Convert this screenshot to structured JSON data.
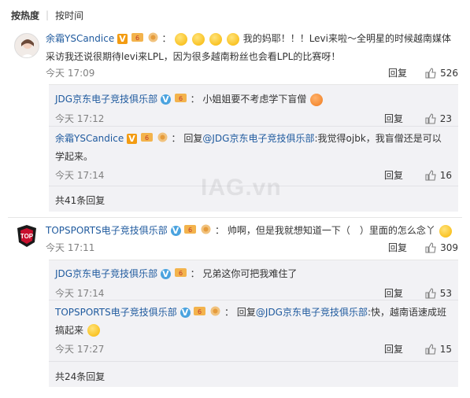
{
  "sort": {
    "hot": "按热度",
    "sep": "|",
    "time": "按时间"
  },
  "comments": [
    {
      "user": "余霜YSCandice",
      "pre_text": "：",
      "text": "我的妈耶！！！Levi来啦～全明星的时候越南媒体采访我还说很期待levi来LPL，因为很多越南粉丝也会看LPL的比赛呀！",
      "time": "今天 17:09",
      "reply": "回复",
      "likes": "526",
      "sub_comments": [
        {
          "user": "JDG京东电子竞技俱乐部",
          "sep": "：",
          "text": "小姐姐要不考虑学下盲僧",
          "time": "今天 17:12",
          "reply": "回复",
          "likes": "23"
        },
        {
          "user": "余霜YSCandice",
          "sep": "：",
          "text_prefix": "回复",
          "mention": "@JDG京东电子竞技俱乐部",
          "text": ":我觉得ojbk，我盲僧还是可以学起来。",
          "time": "今天 17:14",
          "reply": "回复",
          "likes": "16"
        }
      ],
      "more": "共41条回复"
    },
    {
      "user": "TOPSPORTS电子竞技俱乐部",
      "pre_text": "：",
      "text": "帅啊，但是我就想知道一下（　）里面的怎么念丫",
      "time": "今天 17:11",
      "reply": "回复",
      "likes": "309",
      "sub_comments": [
        {
          "user": "JDG京东电子竞技俱乐部",
          "sep": "：",
          "text": "兄弟这你可把我难住了",
          "time": "今天 17:14",
          "reply": "回复",
          "likes": "53"
        },
        {
          "user": "TOPSPORTS电子竞技俱乐部",
          "sep": "：",
          "text_prefix": "回复",
          "mention": "@JDG京东电子竞技俱乐部",
          "text": ":快，越南语速成班搞起来",
          "time": "今天 17:27",
          "reply": "回复",
          "likes": "15"
        }
      ],
      "more": "共24条回复"
    }
  ],
  "avatar_top_text": "TOP",
  "watermark": "IAG.vn",
  "colors": {
    "username": "#1f8a70",
    "link": "#1f5a9e",
    "meta": "#808080",
    "subbg": "#f2f2f5"
  }
}
